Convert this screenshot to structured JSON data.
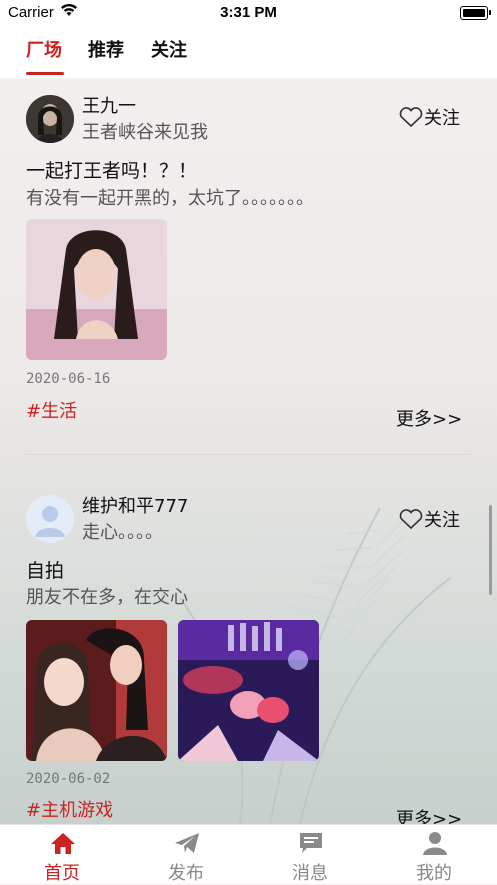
{
  "status_bar": {
    "carrier": "Carrier",
    "time": "3:31 PM"
  },
  "top_tabs": [
    {
      "label": "厂场",
      "active": true
    },
    {
      "label": "推荐",
      "active": false
    },
    {
      "label": "关注",
      "active": false
    }
  ],
  "posts": [
    {
      "username": "王九一",
      "signature": "王者峡谷来见我",
      "follow_label": "关注",
      "title": "一起打王者吗！？！",
      "body": "有没有一起开黑的，太坑了。。。。。。。",
      "date": "2020-06-16",
      "tag": "#生活",
      "more_label": "更多>>",
      "photos": [
        "portrait-photo"
      ]
    },
    {
      "username": "维护和平777",
      "signature": "走心。。。。",
      "follow_label": "关注",
      "title": "自拍",
      "body": "朋友不在多，在交心",
      "date": "2020-06-02",
      "tag": "#主机游戏",
      "more_label": "更多>>",
      "photos": [
        "selfie-photo",
        "party-photo"
      ]
    }
  ],
  "bottom_nav": [
    {
      "label": "首页",
      "icon": "home-icon",
      "active": true
    },
    {
      "label": "发布",
      "icon": "send-icon",
      "active": false
    },
    {
      "label": "消息",
      "icon": "message-icon",
      "active": false
    },
    {
      "label": "我的",
      "icon": "user-icon",
      "active": false
    }
  ],
  "colors": {
    "accent": "#cc2222",
    "text": "#111111",
    "muted": "#555555"
  }
}
